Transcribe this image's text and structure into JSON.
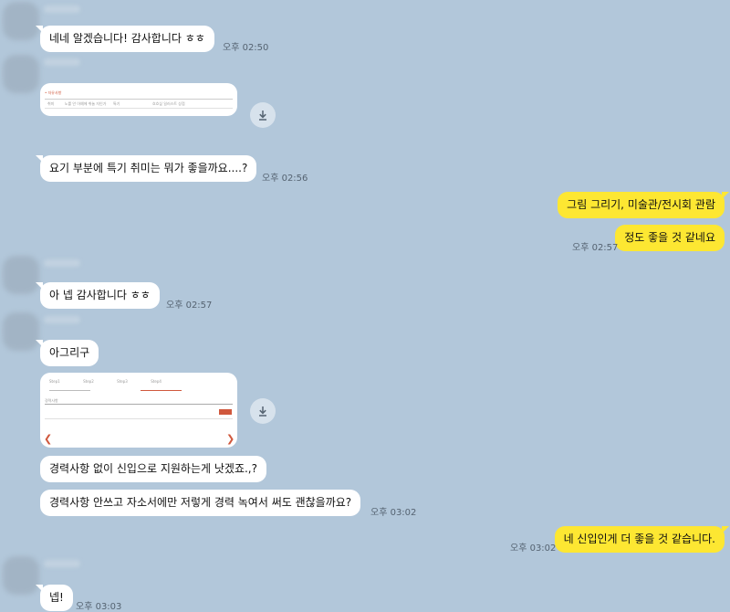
{
  "messages": [
    {
      "id": "m1",
      "text": "네네 알겠습니다! 감사합니다 ㅎㅎ",
      "time": "오후 02:50"
    },
    {
      "id": "m2",
      "image": "attached-image-1"
    },
    {
      "id": "m3",
      "text": "요기 부분에 특기 취미는 뭐가 좋을까요....?",
      "time": "오후 02:56"
    },
    {
      "id": "m4",
      "text": "그림 그리기, 미술관/전시회 관람"
    },
    {
      "id": "m5",
      "text": "정도 좋을 것 같네요",
      "time": "오후 02:57"
    },
    {
      "id": "m6",
      "text": "아 넵 감사합니다 ㅎㅎ",
      "time": "오후 02:57"
    },
    {
      "id": "m7",
      "text": "아그리구"
    },
    {
      "id": "m8",
      "image": "attached-image-2"
    },
    {
      "id": "m9",
      "text": "경력사항 없이 신입으로 지원하는게 낫겠죠.,?"
    },
    {
      "id": "m10",
      "text": "경력사항 안쓰고 자소서에만 저렇게 경력 녹여서 써도 괜찮을까요?",
      "time": "오후 03:02"
    },
    {
      "id": "m11",
      "text": "네 신입인게 더 좋을 것 같습니다.",
      "time": "오후 03:02"
    },
    {
      "id": "m12",
      "text": "넵!",
      "time": "오후 03:03"
    }
  ],
  "colors": {
    "background": "#b2c7da",
    "my_bubble": "#fde732",
    "their_bubble": "#ffffff"
  }
}
